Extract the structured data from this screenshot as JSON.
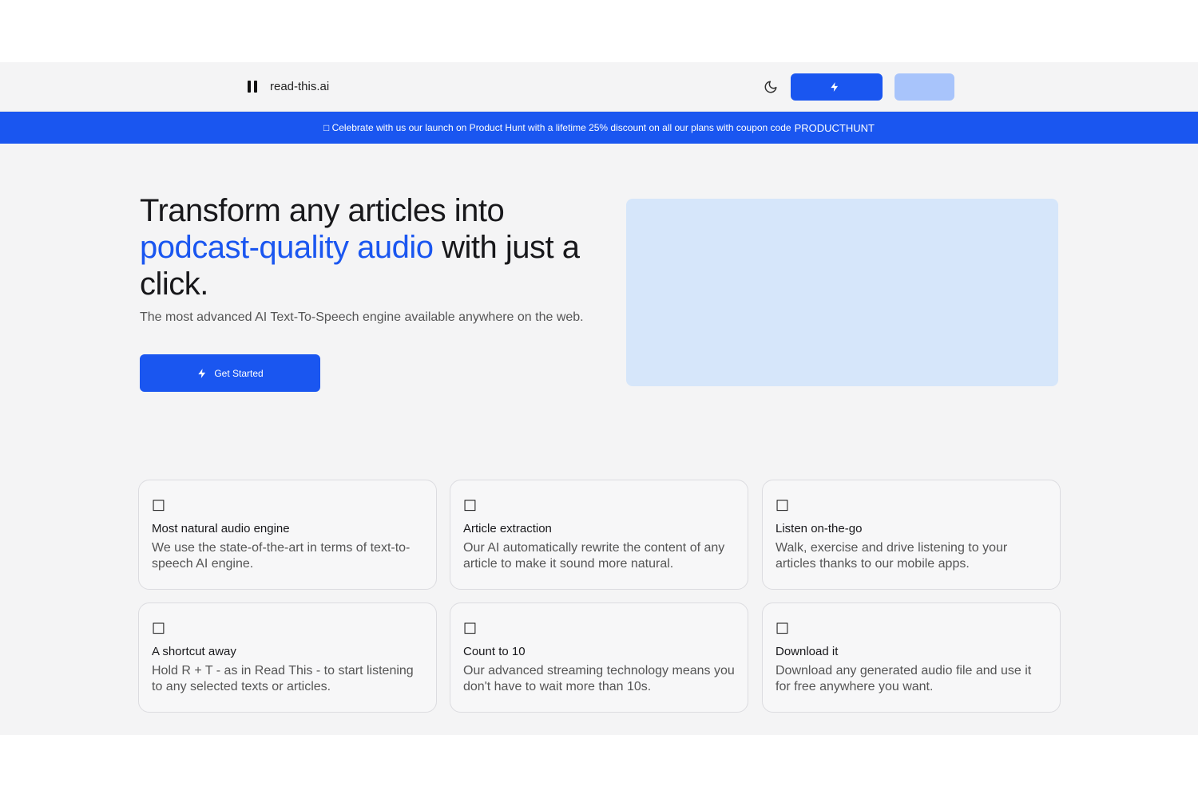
{
  "header": {
    "brand_name": "read-this.ai",
    "theme_toggle_icon": "moon-icon",
    "primary_button_label": "",
    "secondary_button_label": ""
  },
  "banner": {
    "text": "□ Celebrate with us our launch on Product Hunt with a lifetime 25% discount on all our plans with coupon code",
    "code": "PRODUCTHUNT"
  },
  "hero": {
    "title_part1": "Transform any articles into",
    "title_accent": "podcast-quality audio",
    "title_part2": "with just a click.",
    "subtitle": "The most advanced AI Text-To-Speech engine available anywhere on the web.",
    "cta_label": "Get Started"
  },
  "features": [
    {
      "icon": "□",
      "title": "Most natural audio engine",
      "desc": "We use the state-of-the-art in terms of text-to-speech AI engine."
    },
    {
      "icon": "□",
      "title": "Article extraction",
      "desc": "Our AI automatically rewrite the content of any article to make it sound more natural."
    },
    {
      "icon": "□",
      "title": "Listen on-the-go",
      "desc": "Walk, exercise and drive listening to your articles thanks to our mobile apps."
    },
    {
      "icon": "□",
      "title": "A shortcut away",
      "desc": "Hold R + T - as in Read This - to start listening to any selected texts or articles."
    },
    {
      "icon": "□",
      "title": "Count to 10",
      "desc": "Our advanced streaming technology means you don't have to wait more than 10s."
    },
    {
      "icon": "□",
      "title": "Download it",
      "desc": "Download any generated audio file and use it for free anywhere you want."
    }
  ],
  "colors": {
    "accent": "#1a56f0",
    "page_bg": "#f4f4f5",
    "hero_media_bg": "#d6e6fa"
  }
}
